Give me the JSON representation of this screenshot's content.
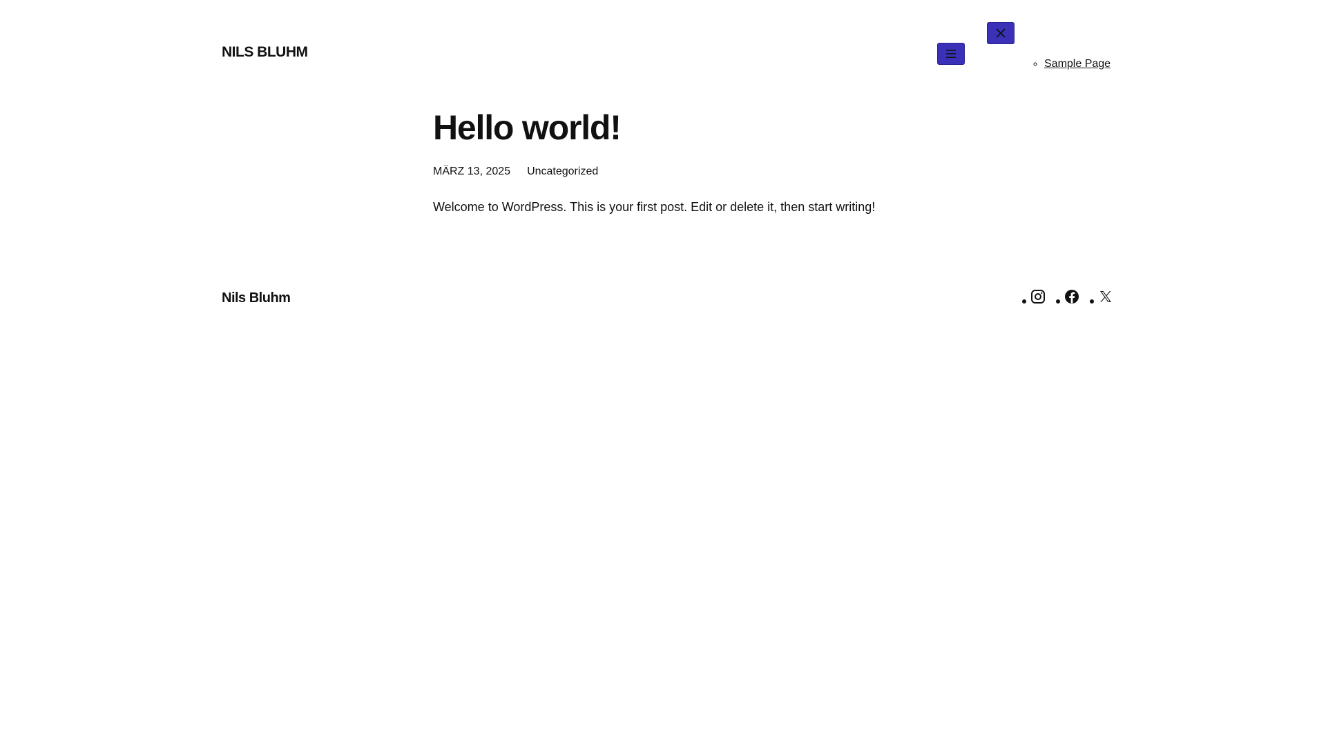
{
  "header": {
    "site_title": "NILS BLUHM",
    "menu_open_icon": "hamburger-menu-icon",
    "menu_close_icon": "close-icon",
    "nav": [
      {
        "label": "Sample Page"
      }
    ]
  },
  "post": {
    "title": "Hello world!",
    "date": "MÄRZ 13, 2025",
    "category": "Uncategorized",
    "content": "Welcome to WordPress. This is your first post. Edit or delete it, then start writing!"
  },
  "footer": {
    "site_title": "Nils Bluhm",
    "social": [
      {
        "icon": "instagram-icon"
      },
      {
        "icon": "facebook-icon"
      },
      {
        "icon": "x-icon"
      }
    ]
  },
  "colors": {
    "accent": "#3a31b8",
    "text": "#111111",
    "background": "#ffffff"
  }
}
